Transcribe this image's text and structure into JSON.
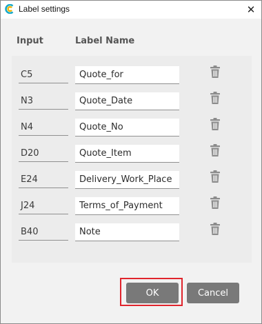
{
  "window": {
    "title": "Label settings",
    "close_glyph": "✕"
  },
  "headers": {
    "input": "Input",
    "label_name": "Label Name"
  },
  "rows": [
    {
      "input": "C5",
      "label": "Quote_for"
    },
    {
      "input": "N3",
      "label": "Quote_Date"
    },
    {
      "input": "N4",
      "label": "Quote_No"
    },
    {
      "input": "D20",
      "label": "Quote_Item"
    },
    {
      "input": "E24",
      "label": "Delivery_Work_Place"
    },
    {
      "input": "J24",
      "label": "Terms_of_Payment"
    },
    {
      "input": "B40",
      "label": "Note"
    }
  ],
  "buttons": {
    "ok": "OK",
    "cancel": "Cancel"
  },
  "icons": {
    "app": "app-logo-icon",
    "delete": "trash-icon",
    "close": "close-icon"
  },
  "colors": {
    "button": "#797979",
    "highlight": "#e0242c",
    "icon": "#8c8c8c"
  }
}
